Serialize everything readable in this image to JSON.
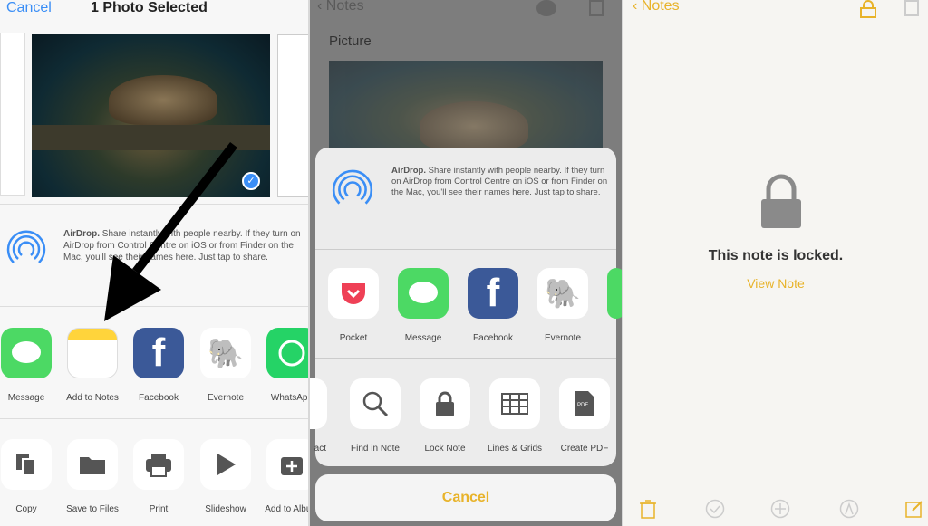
{
  "left": {
    "cancel": "Cancel",
    "title": "1 Photo Selected",
    "airdrop": {
      "bold": "AirDrop.",
      "text": " Share instantly with people nearby. If they turn on AirDrop from Control Centre on iOS or from Finder on the Mac, you'll see their names here. Just tap to share."
    },
    "apps": [
      {
        "label": "Message",
        "icon": "message-icon"
      },
      {
        "label": "Add to Notes",
        "icon": "notes-icon"
      },
      {
        "label": "Facebook",
        "icon": "facebook-icon"
      },
      {
        "label": "Evernote",
        "icon": "evernote-icon"
      },
      {
        "label": "WhatsApp",
        "icon": "whatsapp-icon"
      }
    ],
    "actions": [
      {
        "label": "Copy",
        "icon": "copy-icon"
      },
      {
        "label": "Save to Files",
        "icon": "folder-icon"
      },
      {
        "label": "Print",
        "icon": "print-icon"
      },
      {
        "label": "Slideshow",
        "icon": "play-icon"
      },
      {
        "label": "Add to Album",
        "icon": "add-album-icon"
      }
    ]
  },
  "middle": {
    "back": "Notes",
    "note_title": "Picture",
    "airdrop": {
      "bold": "AirDrop.",
      "text": " Share instantly with people nearby. If they turn on AirDrop from Control Centre on iOS or from Finder on the Mac, you'll see their names here. Just tap to share."
    },
    "apps": [
      {
        "label": "Pocket",
        "icon": "pocket-icon"
      },
      {
        "label": "Message",
        "icon": "message-icon"
      },
      {
        "label": "Facebook",
        "icon": "facebook-icon"
      },
      {
        "label": "Evernote",
        "icon": "evernote-icon"
      }
    ],
    "actions": [
      {
        "label": "act",
        "icon": "contact-icon"
      },
      {
        "label": "Find in Note",
        "icon": "search-icon"
      },
      {
        "label": "Lock Note",
        "icon": "lock-icon"
      },
      {
        "label": "Lines & Grids",
        "icon": "grid-icon"
      },
      {
        "label": "Create PDF",
        "icon": "pdf-icon"
      }
    ],
    "cancel": "Cancel"
  },
  "right": {
    "back": "Notes",
    "locked": "This note is locked.",
    "view": "View Note"
  },
  "colors": {
    "ios_blue": "#3a8ef6",
    "notes_yellow": "#e8b32a"
  }
}
